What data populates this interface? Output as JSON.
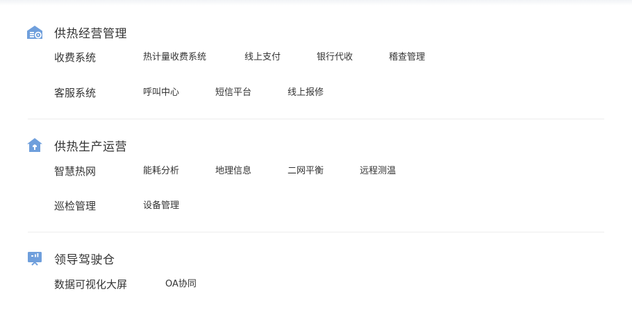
{
  "colors": {
    "icon_blue": "#6f9fdc",
    "icon_light": "#ffffff",
    "divider": "#ececec",
    "text": "#333333"
  },
  "sections": [
    {
      "title": "供热经营管理",
      "icon": "house-gear-icon",
      "rows": [
        {
          "label": "收费系统",
          "items": [
            "热计量收费系统",
            "线上支付",
            "银行代收",
            "稽查管理"
          ]
        },
        {
          "label": "客服系统",
          "items": [
            "呼叫中心",
            "短信平台",
            "线上报修"
          ]
        }
      ]
    },
    {
      "title": "供热生产运营",
      "icon": "house-wrench-icon",
      "rows": [
        {
          "label": "智慧热网",
          "items": [
            "能耗分析",
            "地理信息",
            "二网平衡",
            "远程测温"
          ]
        },
        {
          "label": "巡检管理",
          "items": [
            "设备管理"
          ]
        }
      ]
    },
    {
      "title": "领导驾驶仓",
      "icon": "dashboard-screen-icon",
      "rows": [
        {
          "label": "数据可视化大屏",
          "items": [
            "OA协同"
          ]
        }
      ]
    }
  ]
}
